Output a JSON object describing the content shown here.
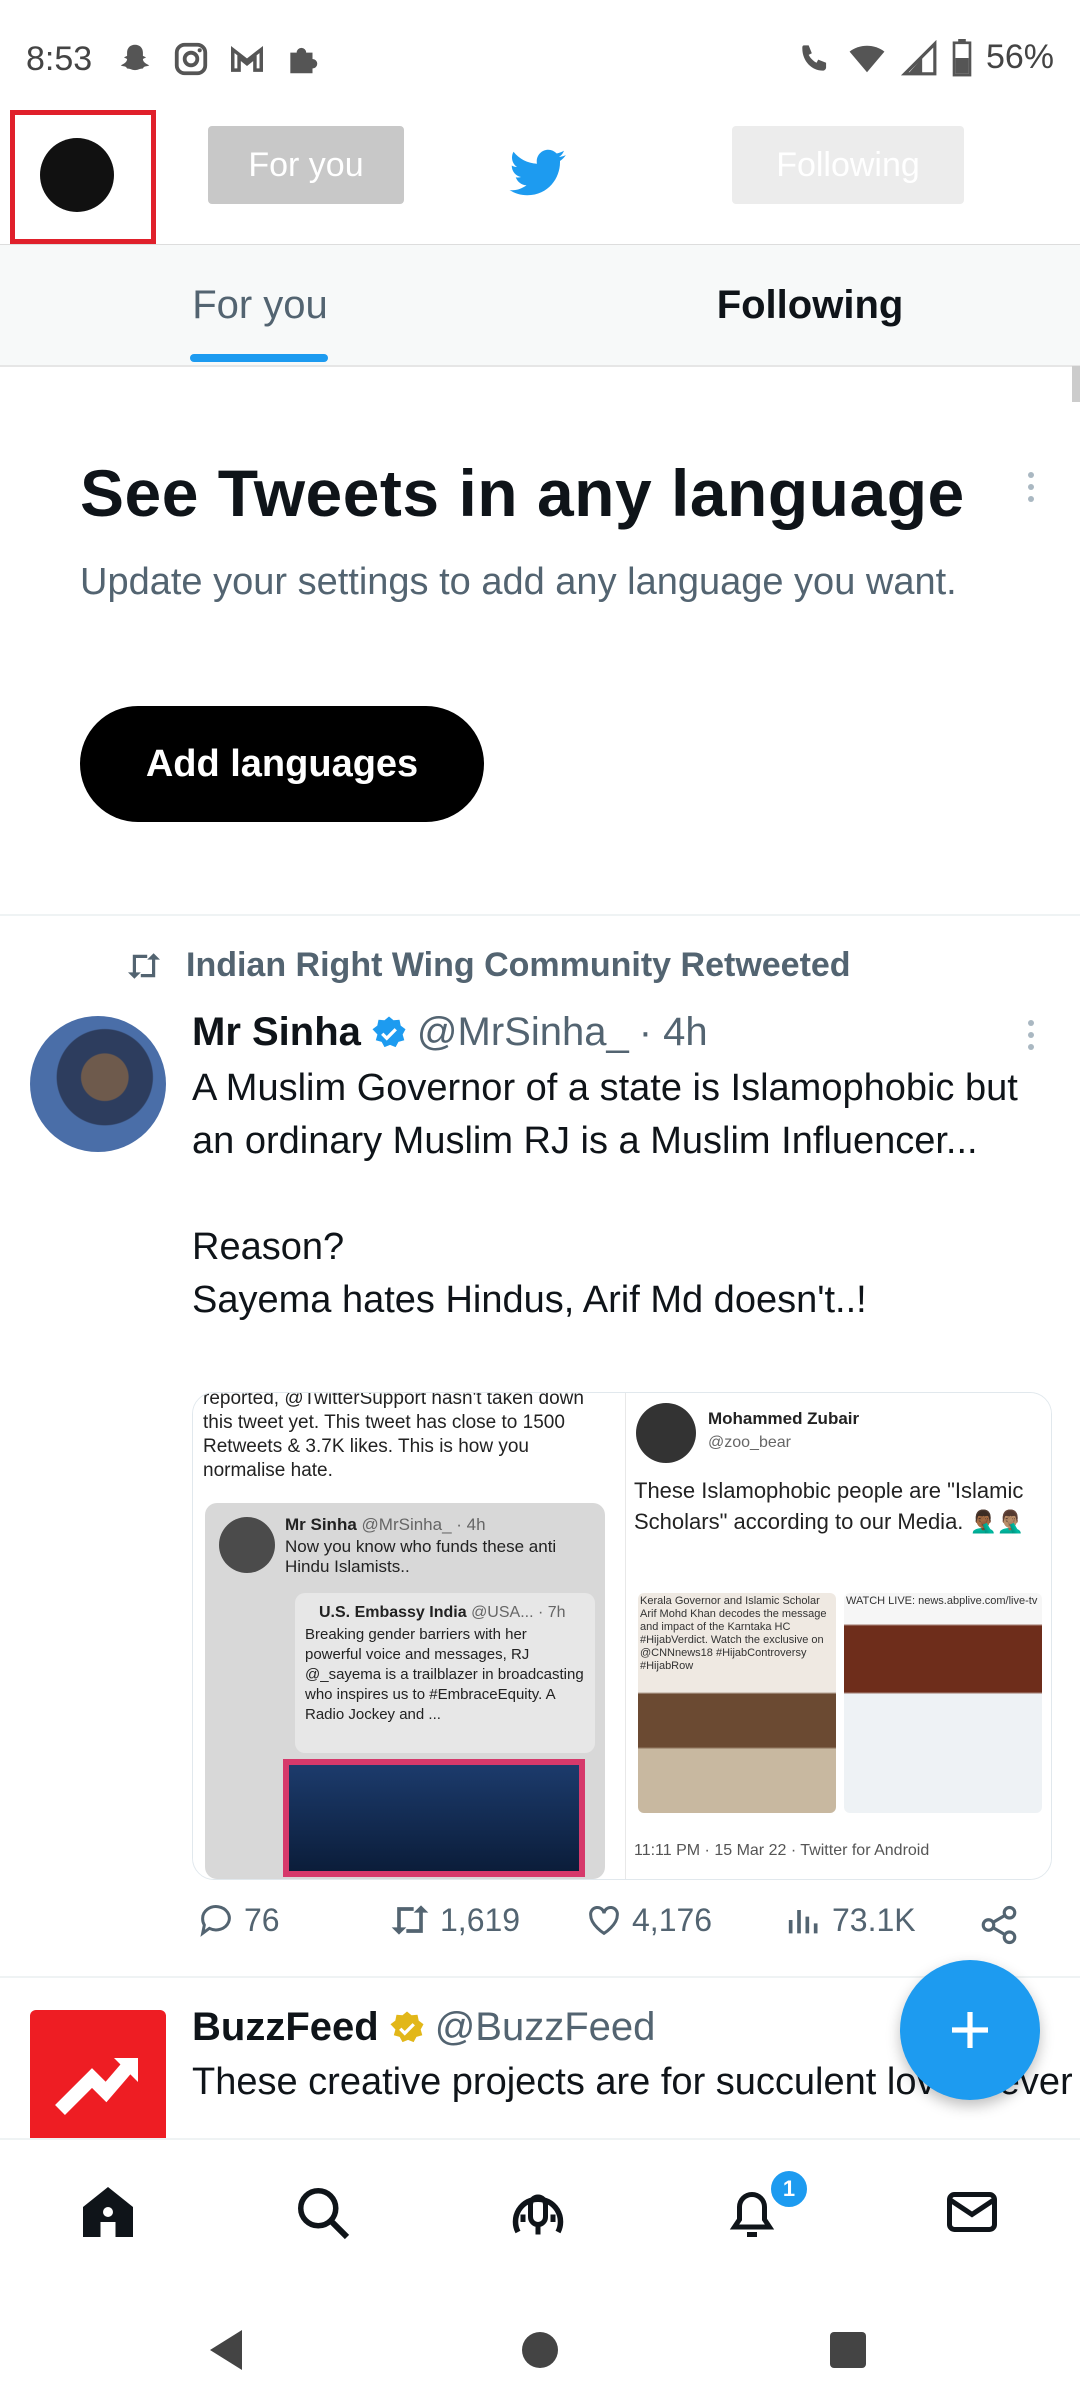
{
  "status_bar": {
    "time": "8:53",
    "battery": "56%",
    "left_icons": [
      "snapchat-icon",
      "instagram-icon",
      "gmail-icon",
      "puzzle-icon"
    ],
    "right_icons": [
      "wifi-call-icon",
      "wifi-icon",
      "signal-icon",
      "battery-icon"
    ]
  },
  "header": {
    "pill_for_you": "For you",
    "pill_following": "Following"
  },
  "tabs": {
    "for_you": "For you",
    "following": "Following"
  },
  "promo": {
    "title": "See Tweets in any language",
    "subtitle": "Update your settings to add any language you want.",
    "button": "Add languages"
  },
  "tweet": {
    "retweeted_by": "Indian Right Wing Community Retweeted",
    "name": "Mr Sinha",
    "handle": "@MrSinha_",
    "time": "· 4h",
    "text": "A Muslim Governor of a state is Islamophobic but an ordinary Muslim RJ is a Muslim Influencer...\n\nReason?\nSayema hates Hindus, Arif Md doesn't..!",
    "media_left": {
      "top_text": "reported, @TwitterSupport hasn't taken down this tweet yet. This tweet has close to 1500 Retweets & 3.7K likes. This is how you normalise hate.",
      "quote_name": "Mr Sinha",
      "quote_handle": "@MrSinha_ · 4h",
      "quote_text": "Now you know who funds these anti Hindu Islamists..",
      "inner_name": "U.S. Embassy India",
      "inner_handle": "@USA... · 7h",
      "inner_text": "Breaking gender barriers with her powerful voice and messages, RJ @_sayema is a trailblazer in broadcasting who inspires us to #EmbraceEquity. A Radio Jockey and ..."
    },
    "media_right": {
      "name": "Mohammed Zubair",
      "handle": "@zoo_bear",
      "text": "These Islamophobic people are \"Islamic Scholars\" according to our Media. 🤦🏾‍♂️🤦🏽‍♂️",
      "caption_left": "Kerala Governor and Islamic Scholar Arif Mohd Khan decodes the message and impact of the Karntaka HC #HijabVerdict. Watch the exclusive on @CNNnews18 #HijabControversy #HijabRow",
      "caption_right": "WATCH LIVE: news.abplive.com/live-tv",
      "footer": "11:11 PM · 15 Mar 22 · Twitter for Android"
    },
    "replies": "76",
    "retweets": "1,619",
    "likes": "4,176",
    "views": "73.1K"
  },
  "tweet2": {
    "name": "BuzzFeed",
    "handle": "@BuzzFeed",
    "text": "These creative projects are for succulent lovers everywhere! 🌱"
  },
  "nav": {
    "notifications_badge": "1"
  },
  "colors": {
    "accent": "#1d9bf0",
    "text": "#0f1419",
    "muted": "#536471",
    "highlight_box": "#e0202b"
  }
}
